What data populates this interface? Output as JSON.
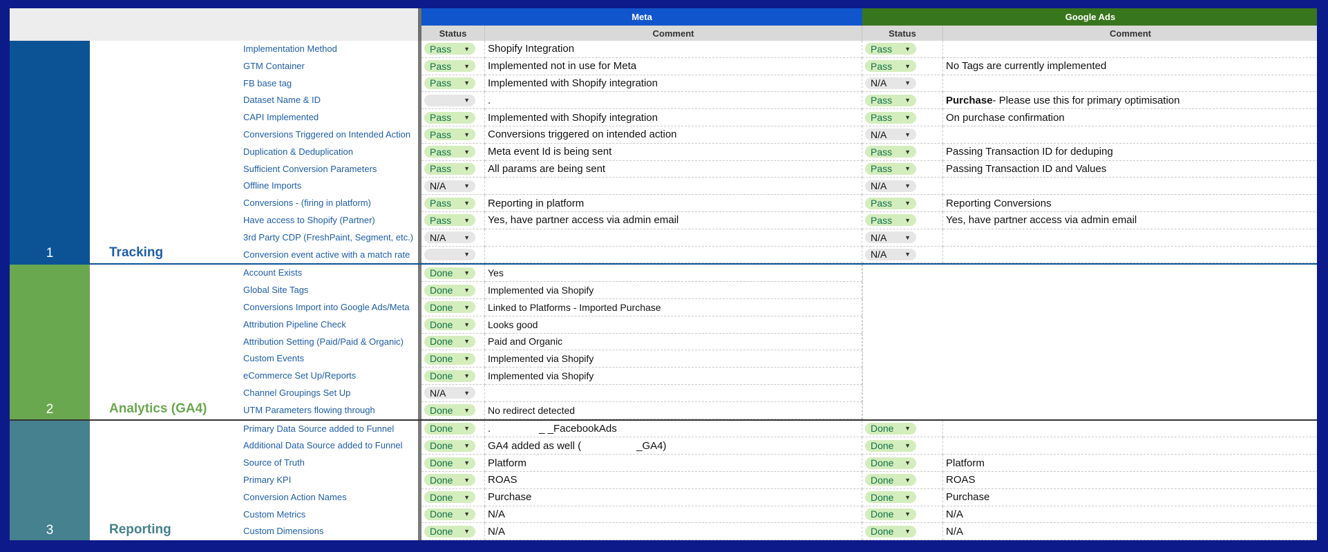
{
  "header": {
    "meta_label": "Meta",
    "gads_label": "Google Ads",
    "status_label": "Status",
    "comment_label": "Comment"
  },
  "colors": {
    "meta_header": "#1155cc",
    "gads_header": "#38761d",
    "tracking": "#0b5394",
    "analytics": "#6aa84f",
    "reporting": "#45818e",
    "chip_green": "#d4edbc",
    "chip_grey": "#e6e6e6"
  },
  "sections": [
    {
      "number": "1",
      "title": "Tracking",
      "rows": [
        {
          "label": "Implementation Method",
          "meta_status": "Pass",
          "meta_comment": "Shopify Integration",
          "gads_status": "Pass",
          "gads_comment": ""
        },
        {
          "label": "GTM Container",
          "meta_status": "Pass",
          "meta_comment": "Implemented not in use for Meta",
          "gads_status": "Pass",
          "gads_comment": "No Tags are currently implemented"
        },
        {
          "label": "FB base tag",
          "meta_status": "Pass",
          "meta_comment": "Implemented with Shopify integration",
          "gads_status": "N/A",
          "gads_comment": ""
        },
        {
          "label": "Dataset Name & ID",
          "meta_status": "",
          "meta_comment": ".",
          "gads_status": "Pass",
          "gads_comment_bold": "Purchase",
          "gads_comment": " - Please use this for primary optimisation"
        },
        {
          "label": "CAPI Implemented",
          "meta_status": "Pass",
          "meta_comment": "Implemented with Shopify integration",
          "gads_status": "Pass",
          "gads_comment": "On purchase confirmation"
        },
        {
          "label": "Conversions Triggered on Intended Action",
          "meta_status": "Pass",
          "meta_comment": "Conversions triggered on intended action",
          "gads_status": "N/A",
          "gads_comment": ""
        },
        {
          "label": "Duplication & Deduplication",
          "meta_status": "Pass",
          "meta_comment": "Meta event Id is being sent",
          "gads_status": "Pass",
          "gads_comment": "Passing Transaction ID for deduping"
        },
        {
          "label": "Sufficient Conversion Parameters",
          "meta_status": "Pass",
          "meta_comment": "All params are being sent",
          "gads_status": "Pass",
          "gads_comment": "Passing Transaction ID and Values"
        },
        {
          "label": "Offline Imports",
          "meta_status": "N/A",
          "meta_comment": "",
          "gads_status": "N/A",
          "gads_comment": ""
        },
        {
          "label": "Conversions - (firing in platform)",
          "meta_status": "Pass",
          "meta_comment": "Reporting in platform",
          "gads_status": "Pass",
          "gads_comment": "Reporting Conversions"
        },
        {
          "label": "Have access to Shopify (Partner)",
          "meta_status": "Pass",
          "meta_comment": "Yes, have partner access via admin email",
          "gads_status": "Pass",
          "gads_comment": "Yes, have partner access via admin email"
        },
        {
          "label": "3rd Party CDP (FreshPaint, Segment, etc.)",
          "meta_status": "N/A",
          "meta_comment": "",
          "gads_status": "N/A",
          "gads_comment": ""
        },
        {
          "label": "Conversion event active with a match rate",
          "meta_status": "",
          "meta_comment": "",
          "gads_status": "N/A",
          "gads_comment": ""
        }
      ]
    },
    {
      "number": "2",
      "title": "Analytics (GA4)",
      "rows": [
        {
          "label": "Account Exists",
          "meta_status": "Done",
          "meta_comment": "Yes"
        },
        {
          "label": "Global Site Tags",
          "meta_status": "Done",
          "meta_comment": "Implemented via Shopify"
        },
        {
          "label": "Conversions Import into Google Ads/Meta",
          "meta_status": "Done",
          "meta_comment": "Linked to Platforms - Imported Purchase"
        },
        {
          "label": "Attribution Pipeline Check",
          "meta_status": "Done",
          "meta_comment": "Looks good"
        },
        {
          "label": "Attribution Setting (Paid/Paid & Organic)",
          "meta_status": "Done",
          "meta_comment": "Paid and Organic"
        },
        {
          "label": "Custom Events",
          "meta_status": "Done",
          "meta_comment": "Implemented via Shopify"
        },
        {
          "label": "eCommerce Set Up/Reports",
          "meta_status": "Done",
          "meta_comment": "Implemented via Shopify"
        },
        {
          "label": "Channel Groupings Set Up",
          "meta_status": "N/A",
          "meta_comment": ""
        },
        {
          "label": "UTM Parameters flowing through",
          "meta_status": "Done",
          "meta_comment": "No redirect detected"
        }
      ]
    },
    {
      "number": "3",
      "title": "Reporting",
      "rows": [
        {
          "label": "Primary Data Source added to Funnel",
          "meta_status": "Done",
          "meta_comment_a": ".",
          "meta_comment_b": "_ _FacebookAds",
          "gads_status": "Done",
          "gads_comment": ""
        },
        {
          "label": "Additional Data Source added to Funnel",
          "meta_status": "Done",
          "meta_comment_a": "GA4 added as well (",
          "meta_comment_b": "_GA4)",
          "gads_status": "Done",
          "gads_comment": ""
        },
        {
          "label": "Source of Truth",
          "meta_status": "Done",
          "meta_comment": "Platform",
          "gads_status": "Done",
          "gads_comment": "Platform"
        },
        {
          "label": "Primary KPI",
          "meta_status": "Done",
          "meta_comment": "ROAS",
          "gads_status": "Done",
          "gads_comment": "ROAS"
        },
        {
          "label": "Conversion Action Names",
          "meta_status": "Done",
          "meta_comment": "Purchase",
          "gads_status": "Done",
          "gads_comment": "Purchase"
        },
        {
          "label": "Custom Metrics",
          "meta_status": "Done",
          "meta_comment": "N/A",
          "gads_status": "Done",
          "gads_comment": "N/A"
        },
        {
          "label": "Custom Dimensions",
          "meta_status": "Done",
          "meta_comment": "N/A",
          "gads_status": "Done",
          "gads_comment": "N/A"
        }
      ]
    }
  ]
}
